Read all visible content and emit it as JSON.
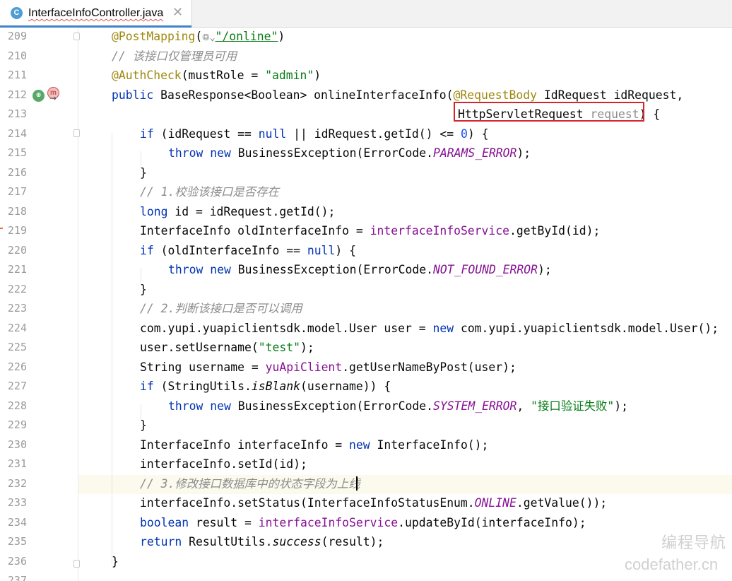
{
  "tab": {
    "title": "InterfaceInfoController.java",
    "icon": "class-icon",
    "icon_letter": "C",
    "close": "✕"
  },
  "lines": [
    {
      "n": "209"
    },
    {
      "n": "210"
    },
    {
      "n": "211"
    },
    {
      "n": "212"
    },
    {
      "n": "213"
    },
    {
      "n": "214"
    },
    {
      "n": "215"
    },
    {
      "n": "216"
    },
    {
      "n": "217"
    },
    {
      "n": "218"
    },
    {
      "n": "219"
    },
    {
      "n": "220"
    },
    {
      "n": "221"
    },
    {
      "n": "222"
    },
    {
      "n": "223"
    },
    {
      "n": "224"
    },
    {
      "n": "225"
    },
    {
      "n": "226"
    },
    {
      "n": "227"
    },
    {
      "n": "228"
    },
    {
      "n": "229"
    },
    {
      "n": "230"
    },
    {
      "n": "231"
    },
    {
      "n": "232"
    },
    {
      "n": "233"
    },
    {
      "n": "234"
    },
    {
      "n": "235"
    },
    {
      "n": "236"
    },
    {
      "n": "237"
    }
  ],
  "code": {
    "l209_ann": "@PostMapping",
    "l209_open": "(",
    "l209_str": "\"/online\"",
    "l209_close": ")",
    "l210": "// 该接口仅管理员可用",
    "l211_ann": "@AuthCheck",
    "l211_rest": "(mustRole = ",
    "l211_str": "\"admin\"",
    "l211_end": ")",
    "l212_kw": "public",
    "l212_a": " BaseResponse<Boolean> onlineInterfaceInfo(",
    "l212_ann": "@RequestBody",
    "l212_b": " IdRequest idRequest,",
    "l213_a": "HttpServletRequest ",
    "l213_hint": "request",
    "l213_b": ") {",
    "l214_kw": "if",
    "l214_a": " (idRequest == ",
    "l214_null": "null",
    "l214_b": " || idRequest.getId() <= ",
    "l214_num": "0",
    "l214_c": ") {",
    "l215_kw1": "throw",
    "l215_kw2": "new",
    "l215_a": " BusinessException(ErrorCode.",
    "l215_const": "PARAMS_ERROR",
    "l215_b": ");",
    "l216": "}",
    "l217": "// 1.校验该接口是否存在",
    "l218_kw": "long",
    "l218_a": " id = idRequest.getId();",
    "l219_a": "InterfaceInfo oldInterfaceInfo = ",
    "l219_fld": "interfaceInfoService",
    "l219_b": ".getById(id);",
    "l220_kw": "if",
    "l220_a": " (oldInterfaceInfo == ",
    "l220_null": "null",
    "l220_b": ") {",
    "l221_kw1": "throw",
    "l221_kw2": "new",
    "l221_a": " BusinessException(ErrorCode.",
    "l221_const": "NOT_FOUND_ERROR",
    "l221_b": ");",
    "l222": "}",
    "l223": "// 2.判断该接口是否可以调用",
    "l224_a": "com.yupi.yuapiclientsdk.model.User user = ",
    "l224_kw": "new",
    "l224_b": " com.yupi.yuapiclientsdk.model.User();",
    "l225_a": "user.setUsername(",
    "l225_str": "\"test\"",
    "l225_b": ");",
    "l226_a": "String username = ",
    "l226_fld": "yuApiClient",
    "l226_b": ".getUserNameByPost(user);",
    "l227_kw": "if",
    "l227_a": " (StringUtils.",
    "l227_static": "isBlank",
    "l227_b": "(username)) {",
    "l228_kw1": "throw",
    "l228_kw2": "new",
    "l228_a": " BusinessException(ErrorCode.",
    "l228_const": "SYSTEM_ERROR",
    "l228_b": ", ",
    "l228_str": "\"接口验证失败\"",
    "l228_c": ");",
    "l229": "}",
    "l230_a": "InterfaceInfo interfaceInfo = ",
    "l230_kw": "new",
    "l230_b": " InterfaceInfo();",
    "l231": "interfaceInfo.setId(id);",
    "l232": "// 3.修改接口数据库中的状态字段为上线",
    "l233_a": "interfaceInfo.setStatus(InterfaceInfoStatusEnum.",
    "l233_const": "ONLINE",
    "l233_b": ".getValue());",
    "l234_kw": "boolean",
    "l234_a": " result = ",
    "l234_fld": "interfaceInfoService",
    "l234_b": ".updateById(interfaceInfo);",
    "l235_kw": "return",
    "l235_a": " ResultUtils.",
    "l235_static": "success",
    "l235_b": "(result);",
    "l236": "}"
  },
  "watermark": {
    "line1": "编程导航",
    "line2": "codefather.cn"
  },
  "colors": {
    "keyword": "#0033b3",
    "annotation": "#9e880d",
    "string": "#067d17",
    "comment": "#8c8c8c",
    "field": "#871094",
    "highlight_box": "#d3252b"
  }
}
